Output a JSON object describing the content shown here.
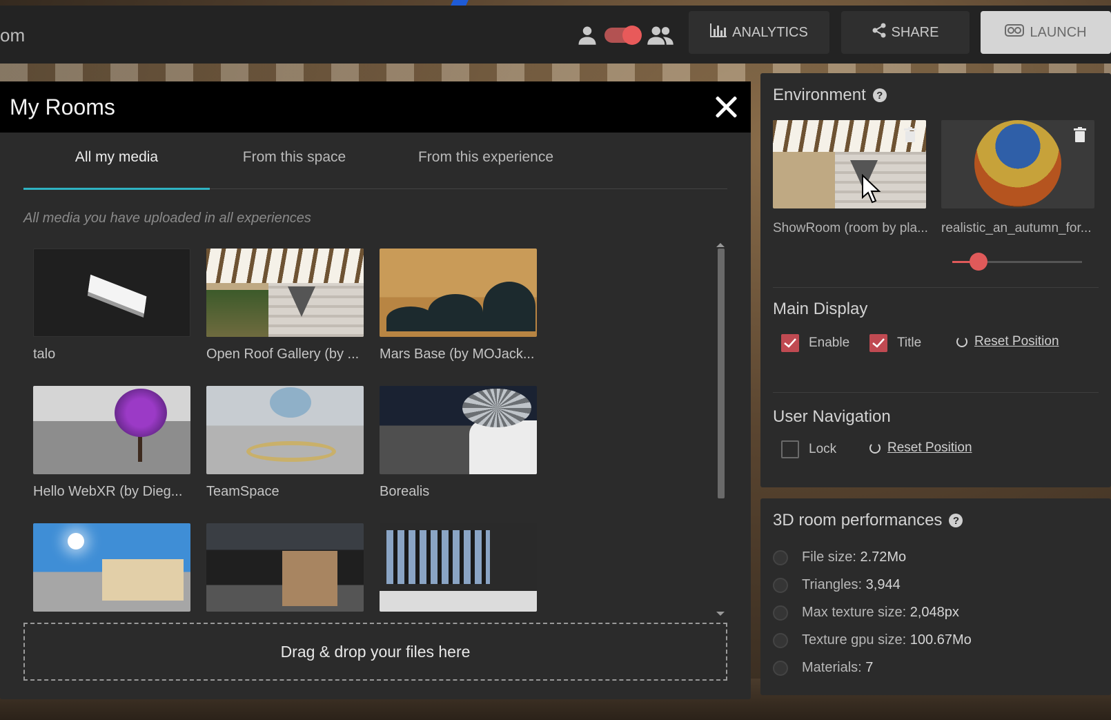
{
  "topbar": {
    "title": "om",
    "analytics_label": "ANALYTICS",
    "share_label": "SHARE",
    "launch_label": "LAUNCH"
  },
  "modal": {
    "title": "My Rooms",
    "tabs": [
      {
        "label": "All my media",
        "active": true
      },
      {
        "label": "From this space",
        "active": false
      },
      {
        "label": "From this experience",
        "active": false
      }
    ],
    "subtitle": "All media you have uploaded in all experiences",
    "items": [
      {
        "label": "talo"
      },
      {
        "label": "Open Roof Gallery (by ..."
      },
      {
        "label": "Mars Base (by MOJack..."
      },
      {
        "label": "Hello WebXR (by Dieg..."
      },
      {
        "label": "TeamSpace"
      },
      {
        "label": "Borealis"
      },
      {
        "label": ""
      },
      {
        "label": ""
      },
      {
        "label": ""
      }
    ],
    "dropzone_label": "Drag & drop your files here"
  },
  "environment": {
    "title": "Environment",
    "help": "?",
    "items": [
      {
        "label": "ShowRoom (room by pla..."
      },
      {
        "label": "realistic_an_autumn_for..."
      }
    ],
    "slider_value": 0.2
  },
  "main_display": {
    "title": "Main Display",
    "enable_label": "Enable",
    "enable_checked": true,
    "title_label": "Title",
    "title_checked": true,
    "reset_label": "Reset Position"
  },
  "user_navigation": {
    "title": "User Navigation",
    "lock_label": "Lock",
    "lock_checked": false,
    "reset_label": "Reset Position"
  },
  "performance": {
    "title": "3D room performances",
    "help": "?",
    "rows": [
      {
        "label": "File size:",
        "value": "2.72Mo"
      },
      {
        "label": "Triangles:",
        "value": "3,944"
      },
      {
        "label": "Max texture size:",
        "value": "2,048px"
      },
      {
        "label": "Texture gpu size:",
        "value": "100.67Mo"
      },
      {
        "label": "Materials:",
        "value": "7"
      }
    ]
  },
  "colors": {
    "accent_tab": "#2fb3c3",
    "toggle_red": "#e85a5a",
    "checkbox_red": "#c04a52"
  }
}
